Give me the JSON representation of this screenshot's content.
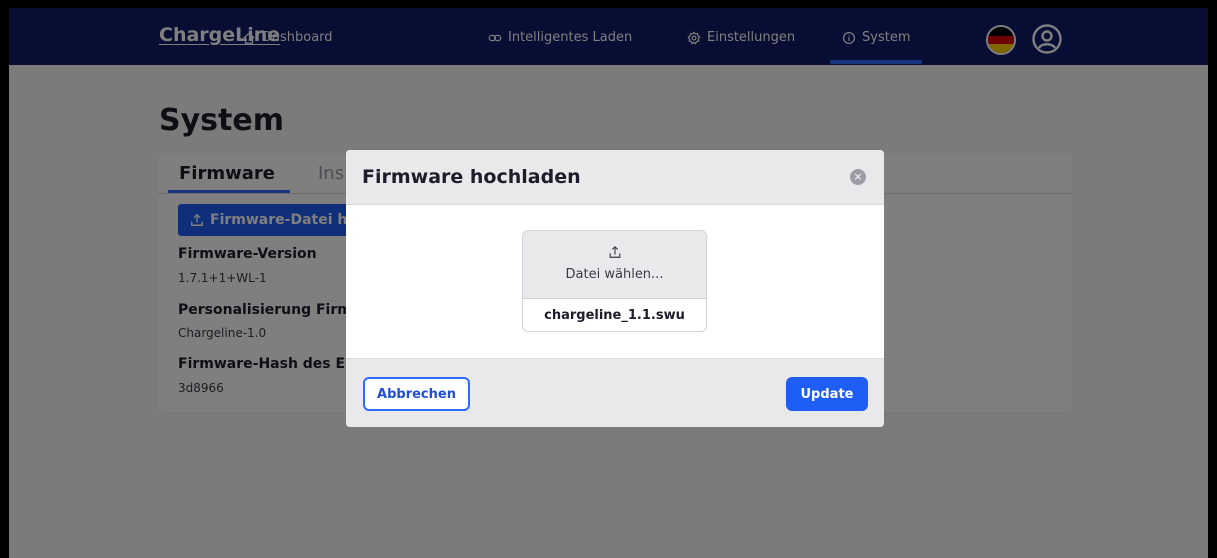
{
  "nav": {
    "logo": "ChargeLine",
    "items": [
      {
        "label": "Dashboard",
        "icon": "home-icon"
      },
      {
        "label": "Intelligentes Laden",
        "icon": "link-icon"
      },
      {
        "label": "Einstellungen",
        "icon": "gear-icon"
      },
      {
        "label": "System",
        "icon": "info-icon",
        "active": true
      }
    ]
  },
  "page": {
    "title": "System",
    "tabs": [
      "Firmware",
      "Ins"
    ],
    "upload_button": "Firmware-Datei h",
    "info": [
      {
        "label": "Firmware-Version",
        "value": "1.7.1+1+WL-1"
      },
      {
        "label": "Personalisierung Firm",
        "value": "Chargeline-1.0"
      },
      {
        "label": "Firmware-Hash des E",
        "value": "3d8966"
      }
    ]
  },
  "modal": {
    "title": "Firmware hochladen",
    "choose_file": "Datei wählen...",
    "file_name": "chargeline_1.1.swu",
    "cancel_label": "Abbrechen",
    "update_label": "Update"
  },
  "colors": {
    "nav_bg": "#0f1a66",
    "accent": "#1f5ef5"
  }
}
